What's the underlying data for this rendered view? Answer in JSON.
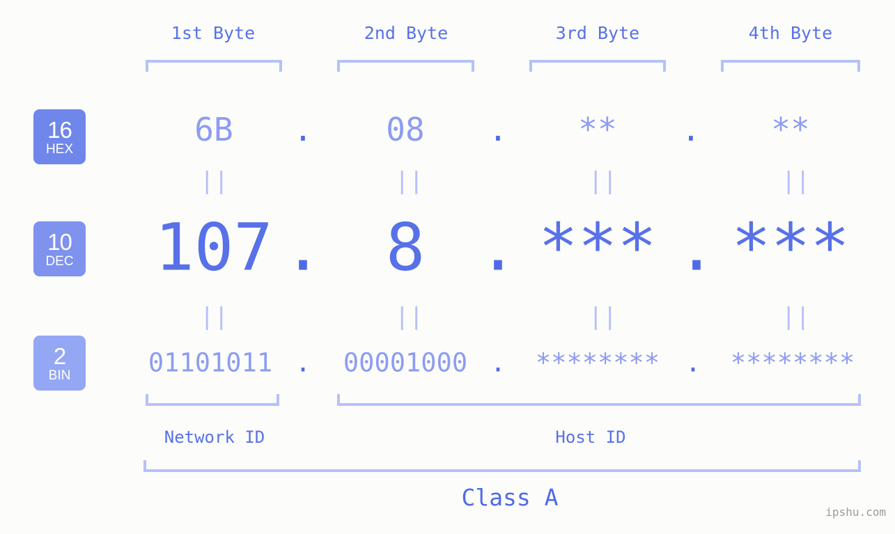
{
  "background_color": "#fcfdfa",
  "accent_color": "#5871e8",
  "accent_light_color": "#8d9cf2",
  "bracket_color": "#b6c0fa",
  "header": {
    "bytes": [
      {
        "label": "1st Byte"
      },
      {
        "label": "2nd Byte"
      },
      {
        "label": "3rd Byte"
      },
      {
        "label": "4th Byte"
      }
    ]
  },
  "radix_badges": [
    {
      "number": "16",
      "name": "HEX",
      "color": "#6f86ea"
    },
    {
      "number": "10",
      "name": "DEC",
      "color": "#7e92ee"
    },
    {
      "number": "2",
      "name": "BIN",
      "color": "#93a7f4"
    }
  ],
  "rows": {
    "hex": {
      "radix": "16",
      "radix_name": "HEX",
      "values": [
        "6B",
        "08",
        "**",
        "**"
      ],
      "separator": "."
    },
    "dec": {
      "radix": "10",
      "radix_name": "DEC",
      "values": [
        "107",
        "8",
        "***",
        "***"
      ],
      "separator": "."
    },
    "bin": {
      "radix": "2",
      "radix_name": "BIN",
      "values": [
        "01101011",
        "00001000",
        "********",
        "********"
      ],
      "separator": "."
    }
  },
  "equality_marks": {
    "symbol": "||",
    "count_per_row": 4
  },
  "footer": {
    "network_id_label": "Network ID",
    "host_id_label": "Host ID",
    "class_label": "Class A",
    "watermark": "ipshu.com"
  }
}
